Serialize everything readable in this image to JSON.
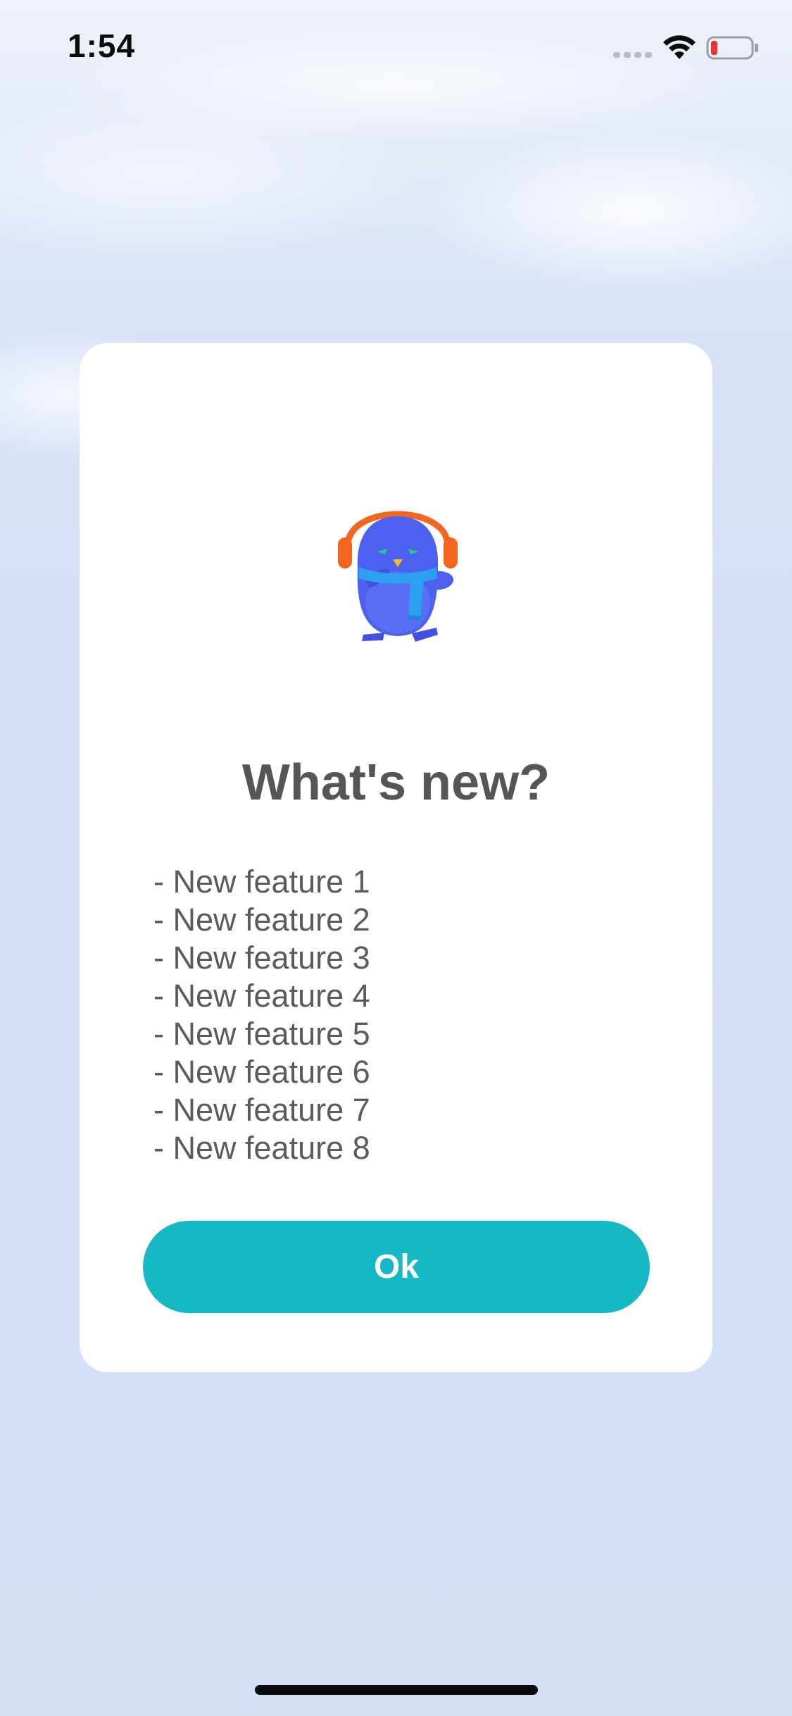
{
  "status_bar": {
    "time": "1:54",
    "icons": [
      "cellular-signal-icon",
      "wifi-icon",
      "battery-low-icon"
    ]
  },
  "dialog": {
    "illustration": "penguin-with-headphones-icon",
    "title": "What's new?",
    "features": [
      "- New feature 1",
      "- New feature 2",
      "- New feature 3",
      "- New feature 4",
      "- New feature 5",
      "- New feature 6",
      "- New feature 7",
      "- New feature 8"
    ],
    "ok_label": "Ok"
  },
  "colors": {
    "accent": "#16b8c6",
    "title_text": "#565656",
    "body_text": "#5b5b5b",
    "background": "#d5e0f7",
    "battery_low": "#e53935"
  }
}
